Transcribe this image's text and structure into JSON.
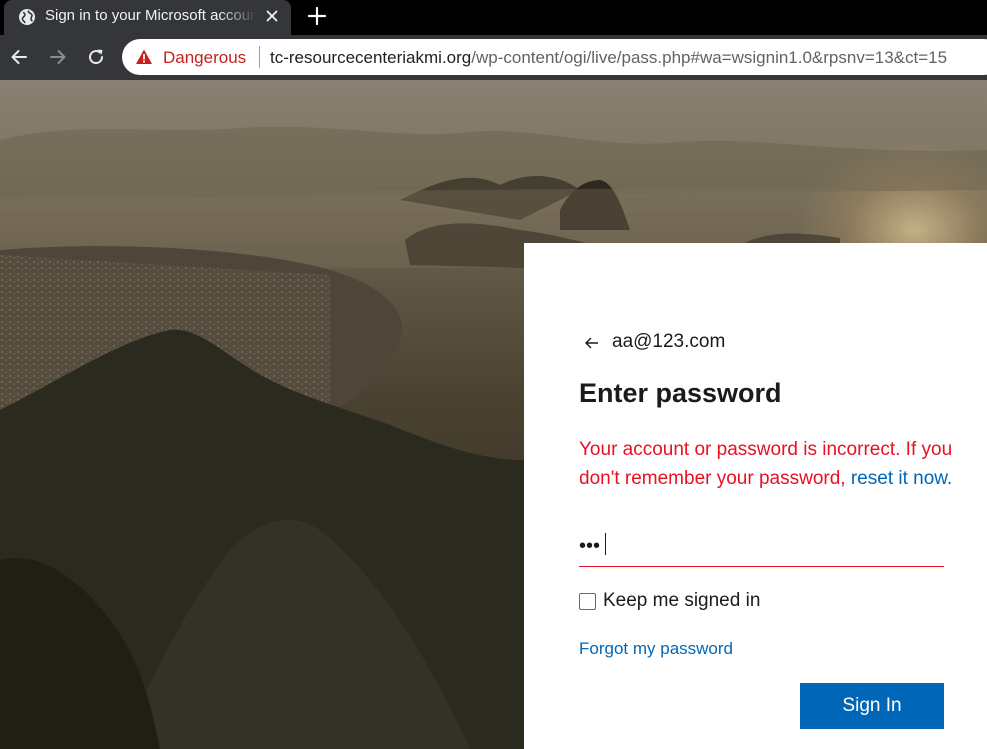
{
  "browser": {
    "tab": {
      "title": "Sign in to your Microsoft account",
      "favicon": "globe-icon"
    },
    "toolbar": {
      "security_label": "Dangerous",
      "url_host": "tc-resourcecenteriakmi.org",
      "url_path": "/wp-content/ogi/live/pass.php#wa=wsignin1.0&rpsnv=13&ct=15",
      "danger_color": "#c5221f"
    }
  },
  "signin": {
    "identity": "aa@123.com",
    "heading": "Enter password",
    "error_text": "Your account or password is incorrect. If you don't remember your password,",
    "error_link": "reset it now.",
    "password_mask": "•••",
    "keep_signed_in_label": "Keep me signed in",
    "keep_signed_in_checked": false,
    "forgot_label": "Forgot my password",
    "submit_label": "Sign In",
    "colors": {
      "error": "#e81123",
      "link": "#0067b8",
      "button": "#0067b8"
    }
  }
}
